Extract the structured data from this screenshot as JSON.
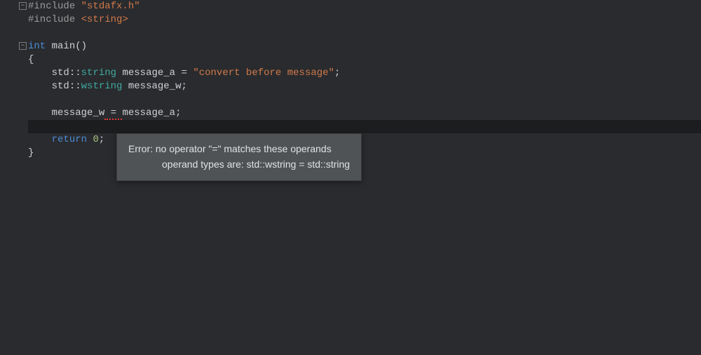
{
  "code": {
    "line1": {
      "preproc": "#",
      "include_kw": "include",
      "space": " ",
      "header": "\"stdafx.h\""
    },
    "line2": {
      "preproc": "#",
      "include_kw": "include",
      "space": " ",
      "open": "<",
      "header": "string",
      "close": ">"
    },
    "line4": {
      "kw_int": "int",
      "space1": " ",
      "fn": "main",
      "parens": "()"
    },
    "line5": {
      "brace": "{"
    },
    "line6": {
      "indent": "    ",
      "ns": "std",
      "coloncolon": "::",
      "type": "string",
      "space": " ",
      "var": "message_a",
      "eq": " = ",
      "str": "\"convert before message\"",
      "semi": ";"
    },
    "line7": {
      "indent": "    ",
      "ns": "std",
      "coloncolon": "::",
      "type": "wstring",
      "space": " ",
      "var": "message_w",
      "semi": ";"
    },
    "line9": {
      "indent": "    ",
      "lhs": "message_w",
      "eq": " = ",
      "rhs": "message_a",
      "semi": ";"
    },
    "line11": {
      "indent": "    ",
      "kw": "return",
      "space": " ",
      "val": "0",
      "semi": ";"
    },
    "line12": {
      "brace": "}"
    }
  },
  "fold_glyph": "−",
  "tooltip": {
    "line1": "Error: no operator \"=\" matches these operands",
    "line2": "operand types are: std::wstring = std::string"
  }
}
